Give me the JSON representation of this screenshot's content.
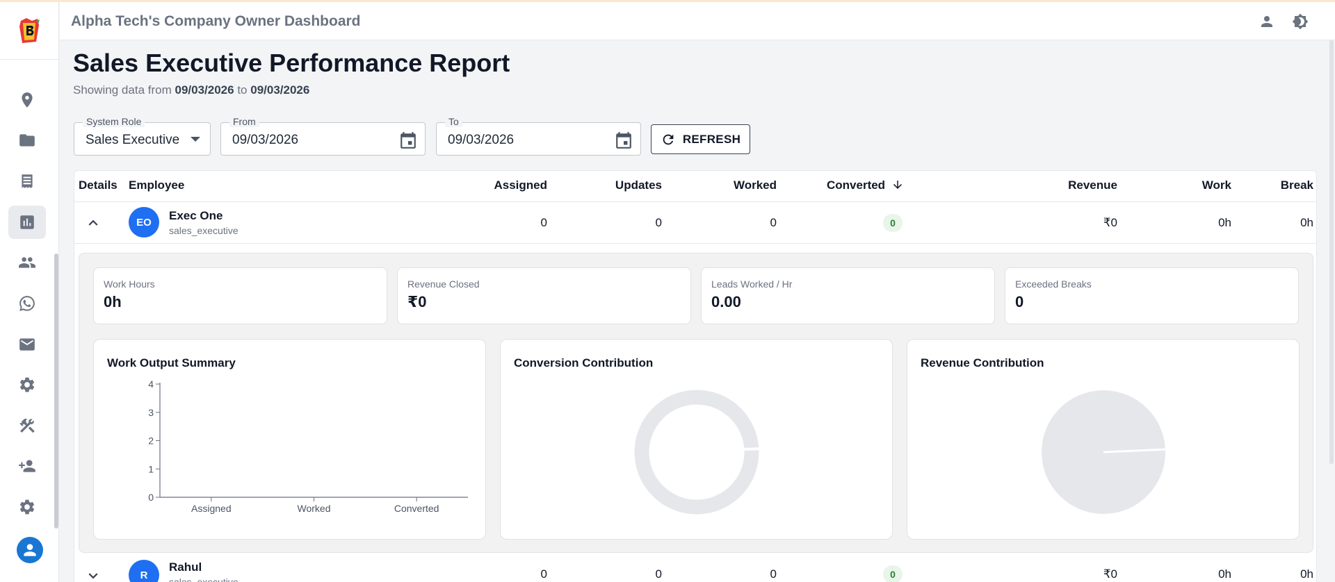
{
  "header": {
    "title": "Alpha Tech's Company Owner Dashboard"
  },
  "page": {
    "title": "Sales Executive Performance Report",
    "subtitle_prefix": "Showing data from",
    "from_date": "09/03/2026",
    "subtitle_middle": "to",
    "to_date": "09/03/2026"
  },
  "filters": {
    "role_label": "System Role",
    "role_value": "Sales Executive",
    "from_label": "From",
    "from_value": "09/03/2026",
    "to_label": "To",
    "to_value": "09/03/2026",
    "refresh_label": "REFRESH"
  },
  "table": {
    "columns": [
      "Details",
      "Employee",
      "Assigned",
      "Updates",
      "Worked",
      "Converted",
      "Revenue",
      "Work",
      "Break"
    ],
    "sorted_column": "Converted",
    "rows": [
      {
        "initials": "EO",
        "name": "Exec One",
        "role": "sales_executive",
        "assigned": "0",
        "updates": "0",
        "worked": "0",
        "converted": "0",
        "revenue": "₹0",
        "work": "0h",
        "break": "0h",
        "expanded": true
      },
      {
        "initials": "R",
        "name": "Rahul",
        "role": "sales_executive",
        "assigned": "0",
        "updates": "0",
        "worked": "0",
        "converted": "0",
        "revenue": "₹0",
        "work": "0h",
        "break": "0h",
        "expanded": false
      }
    ]
  },
  "details": {
    "stats": [
      {
        "label": "Work Hours",
        "value": "0h"
      },
      {
        "label": "Revenue Closed",
        "value": "₹0"
      },
      {
        "label": "Leads Worked / Hr",
        "value": "0.00"
      },
      {
        "label": "Exceeded Breaks",
        "value": "0"
      }
    ]
  },
  "chart_data": [
    {
      "type": "bar",
      "title": "Work Output Summary",
      "categories": [
        "Assigned",
        "Worked",
        "Converted"
      ],
      "values": [
        0,
        0,
        0
      ],
      "ylim": [
        0,
        4
      ],
      "yticks": [
        "0",
        "1",
        "2",
        "3",
        "4"
      ],
      "xlabel": "",
      "ylabel": "",
      "grid": false
    },
    {
      "type": "pie",
      "title": "Conversion Contribution",
      "variant": "donut",
      "labels": [],
      "values": []
    },
    {
      "type": "pie",
      "title": "Revenue Contribution",
      "labels": [],
      "values": []
    }
  ],
  "colors": {
    "accent": "#1976d2",
    "avatar": "#1e6ff2",
    "badge_bg": "#e8f5e9",
    "badge_text": "#2e7d32",
    "chart_empty": "#e6e7ea"
  },
  "icons": {
    "sidebar": [
      "location-icon",
      "folder-icon",
      "receipt-icon",
      "bar-chart-icon",
      "people-icon",
      "whatsapp-icon",
      "mail-icon",
      "settings-icon",
      "tools-icon",
      "add-user-icon",
      "settings-icon",
      "account-icon"
    ],
    "header": [
      "person-icon",
      "brightness-icon"
    ]
  }
}
